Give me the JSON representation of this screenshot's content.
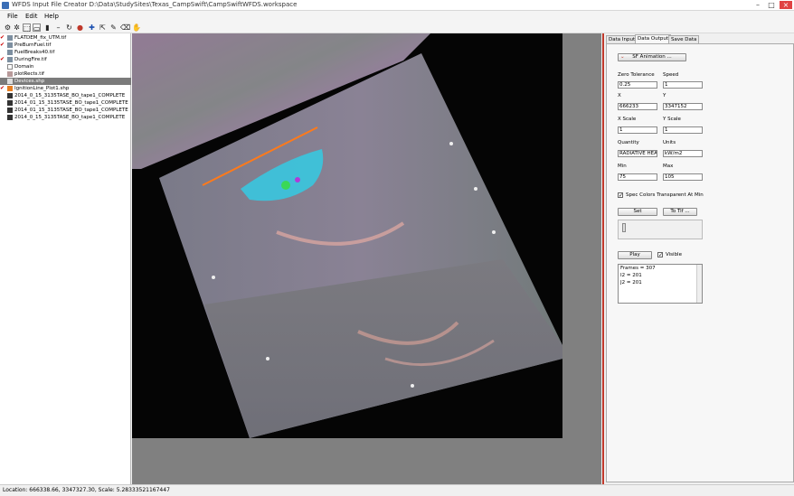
{
  "window": {
    "title": "WFDS Input File Creator   D:\\Data\\StudySites\\Texas_CampSwift\\CampSwiftWFDS.workspace"
  },
  "menu": [
    "File",
    "Edit",
    "Help"
  ],
  "layers": [
    {
      "label": "FLATDEM_fix_UTM.tif",
      "checked": true
    },
    {
      "label": "PreBurnFuel.tif",
      "checked": true
    },
    {
      "label": "FuelBreaks40.tif",
      "checked": false
    },
    {
      "label": "DuringFire.tif",
      "checked": true
    },
    {
      "label": "Domain",
      "checked": false
    },
    {
      "label": "plotRects.tif",
      "checked": false
    },
    {
      "label": "Devices.shp",
      "checked": false,
      "selected": true
    },
    {
      "label": "IgnitionLine_Plot1.shp",
      "checked": true
    },
    {
      "label": "2014_0_15_3135TASE_BO_tape1_COMPLETE",
      "checked": false
    },
    {
      "label": "2014_01_15_3135TASE_BO_tape1_COMPLETE",
      "checked": false
    },
    {
      "label": "2014_01_15_3135TASE_BO_tape1_COMPLETE",
      "checked": false
    },
    {
      "label": "2014_0_15_3135TASE_BO_tape1_COMPLETE",
      "checked": false
    }
  ],
  "tabs": [
    "Data Input",
    "Data Output",
    "Save Data"
  ],
  "panel": {
    "sf_button": "SF Animation ...",
    "zero_tolerance_label": "Zero Tolerance",
    "zero_tolerance": "0.25",
    "speed_label": "Speed",
    "speed": "1",
    "x_label": "X",
    "x": "666233",
    "y_label": "Y",
    "y": "3347152",
    "xscale_label": "X Scale",
    "xscale": "1",
    "yscale_label": "Y Scale",
    "yscale": "1",
    "quantity_label": "Quantity",
    "quantity": "RADIATIVE HEA",
    "units_label": "Units",
    "units": "kW/m2",
    "min_label": "Min",
    "min": "75",
    "max_label": "Max",
    "max": "105",
    "transparent_label": "Spec Colors Transparent At Min",
    "set_button": "Set",
    "totif_button": "To Tif ...",
    "play_button": "Play",
    "visible_label": "Visible",
    "info_lines": [
      "Frames = 307",
      "I2 = 201",
      "J2 = 201"
    ]
  },
  "status": "Location: 666338.66, 3347327.30, Scale: 5.28333521167447"
}
